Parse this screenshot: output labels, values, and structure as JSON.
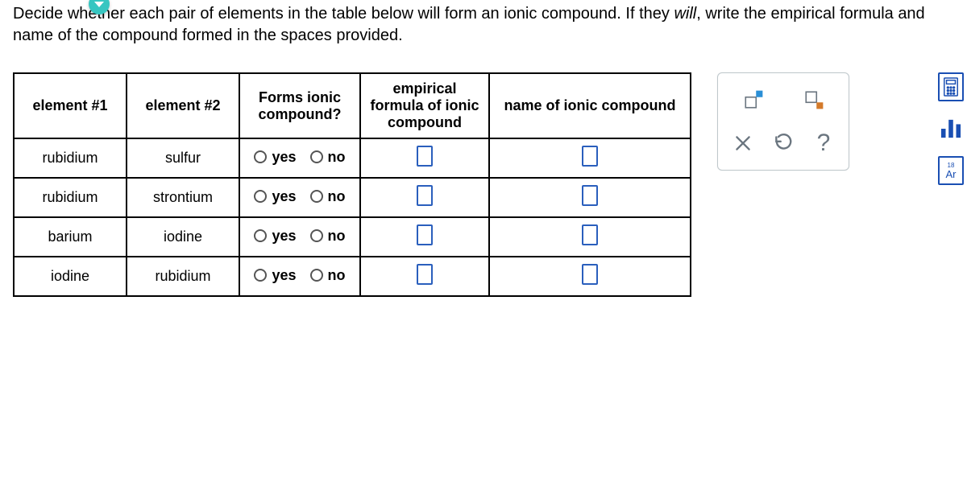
{
  "instructions_pre": "Decide whether each pair of elements in the table below will form an ionic compound. If they ",
  "instructions_em": "will",
  "instructions_post": ", write the empirical formula and name of the compound formed in the spaces provided.",
  "headers": {
    "c1": "element #1",
    "c2": "element #2",
    "c3": "Forms ionic compound?",
    "c4": "empirical formula of ionic compound",
    "c5": "name of ionic compound"
  },
  "options": {
    "yes": "yes",
    "no": "no"
  },
  "rows": [
    {
      "e1": "rubidium",
      "e2": "sulfur"
    },
    {
      "e1": "rubidium",
      "e2": "strontium"
    },
    {
      "e1": "barium",
      "e2": "iodine"
    },
    {
      "e1": "iodine",
      "e2": "rubidium"
    }
  ],
  "toolbox": {
    "super": "super",
    "sub": "sub",
    "clear": "clear",
    "reset": "reset",
    "help": "?"
  },
  "rail": {
    "calc": "calc",
    "graph": "graph",
    "pt": "Ar",
    "pt_num": "18"
  }
}
